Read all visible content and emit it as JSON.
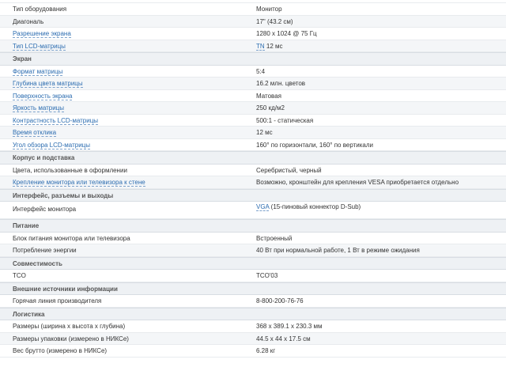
{
  "rows1": [
    {
      "name": "Тип оборудования",
      "value": "Монитор",
      "link": false
    },
    {
      "name": "Диагональ",
      "value": "17\" (43.2 см)",
      "link": false
    },
    {
      "name": "Разрешение экрана",
      "value": "1280 x 1024 @ 75 Гц",
      "link": true
    },
    {
      "name": "Тип LCD-матрицы",
      "value_link": "TN",
      "value_rest": " 12 мс",
      "link": true
    }
  ],
  "section_screen": "Экран",
  "rows2": [
    {
      "name": "Формат матрицы",
      "value": "5:4"
    },
    {
      "name": "Глубина цвета матрицы",
      "value": "16.2 млн. цветов"
    },
    {
      "name": "Поверхность экрана",
      "value": "Матовая"
    },
    {
      "name": "Яркость матрицы",
      "value": "250 кд/м2"
    },
    {
      "name": "Контрастность LCD-матрицы",
      "value": "500:1 - статическая"
    },
    {
      "name": "Время отклика",
      "value": "12 мс"
    },
    {
      "name": "Угол обзора LCD-матрицы",
      "value": "160° по горизонтали, 160° по вертикали"
    }
  ],
  "section_body": "Корпус и подставка",
  "rows3": [
    {
      "name": "Цвета, использованные в оформлении",
      "value": "Серебристый, черный",
      "link": false
    },
    {
      "name": "Крепление монитора или телевизора к стене",
      "value": "Возможно, кронштейн для крепления VESA приобретается отдельно",
      "link": true
    }
  ],
  "section_interfaces": "Интерфейс, разъемы и выходы",
  "interface_row": {
    "name": "Интерфейс монитора",
    "value_link": "VGA",
    "value_rest": " (15-пиновый коннектор D-Sub)"
  },
  "section_power": "Питание",
  "rows4": [
    {
      "name": "Блок питания монитора или телевизора",
      "value": "Встроенный"
    },
    {
      "name": "Потребление энергии",
      "value": "40 Вт при нормальной работе, 1 Вт в режиме ожидания"
    }
  ],
  "section_compat": "Совместимость",
  "rows5": [
    {
      "name": "TCO",
      "value": "TCO'03"
    }
  ],
  "section_sources": "Внешние источники информации",
  "rows6": [
    {
      "name": "Горячая линия производителя",
      "value": "8-800-200-76-76"
    }
  ],
  "section_logistics": "Логистика",
  "rows7": [
    {
      "name": "Размеры (ширина x высота x глубина)",
      "value": "368 x 389.1 x 230.3 мм"
    },
    {
      "name": "Размеры упаковки (измерено в НИКСе)",
      "value": "44.5 x 44 x 17.5 см"
    },
    {
      "name": "Вес брутто (измерено в НИКСе)",
      "value": "6.28 кг"
    }
  ]
}
